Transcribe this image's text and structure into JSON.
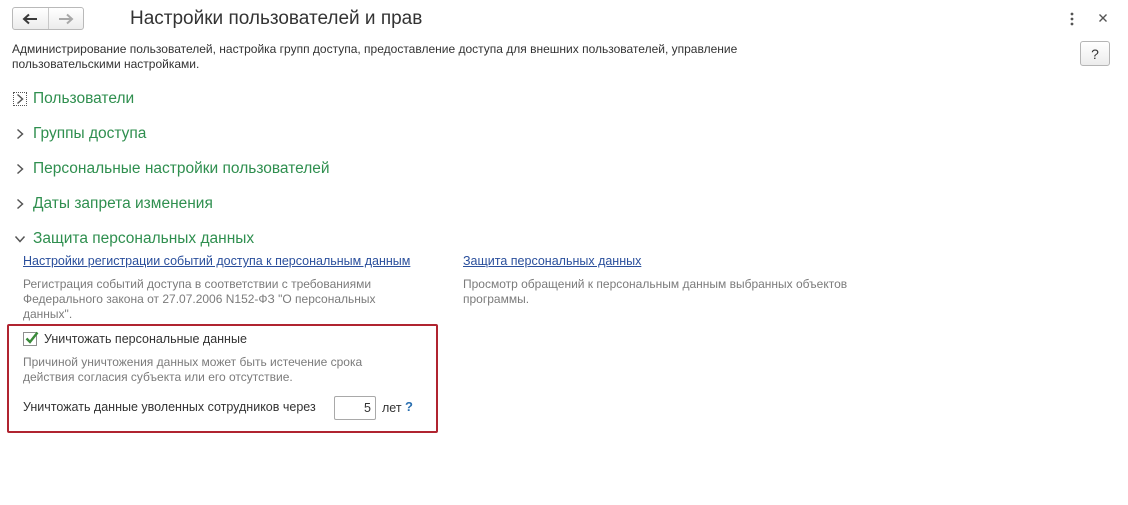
{
  "header": {
    "title": "Настройки пользователей и прав",
    "description": "Администрирование пользователей, настройка групп доступа, предоставление доступа для внешних пользователей, управление пользовательскими настройками.",
    "help_label": "?"
  },
  "sections": [
    {
      "label": "Пользователи",
      "expanded": false
    },
    {
      "label": "Группы доступа",
      "expanded": false
    },
    {
      "label": "Персональные настройки пользователей",
      "expanded": false
    },
    {
      "label": "Даты запрета изменения",
      "expanded": false
    },
    {
      "label": "Защита персональных данных",
      "expanded": true
    }
  ],
  "personal_data": {
    "events_link": "Настройки регистрации событий доступа к персональным данным",
    "events_hint": "Регистрация событий доступа в соответствии с требованиями Федерального закона от 27.07.2006 N152-ФЗ \"О персональных данных\".",
    "protection_link": "Защита персональных данных",
    "protection_hint": "Просмотр обращений к персональным данным выбранных объектов программы.",
    "destroy_checkbox_label": "Уничтожать персональные данные",
    "destroy_checked": true,
    "destroy_hint": "Причиной уничтожения данных может быть истечение срока действия согласия субъекта или его отсутствие.",
    "dismissed_label": "Уничтожать данные уволенных сотрудников через",
    "dismissed_years": "5",
    "dismissed_unit": "лет",
    "dismissed_help": "?"
  },
  "colors": {
    "section_green": "#2f8f4f",
    "link_blue": "#2a4f9c",
    "highlight_red": "#b02430"
  },
  "icons": {
    "back": "arrow-left-icon",
    "forward": "arrow-right-icon",
    "more": "more-vertical-icon",
    "close": "close-icon",
    "collapsed": "chevron-right-icon",
    "expanded": "chevron-down-icon",
    "check": "checkmark-icon"
  }
}
